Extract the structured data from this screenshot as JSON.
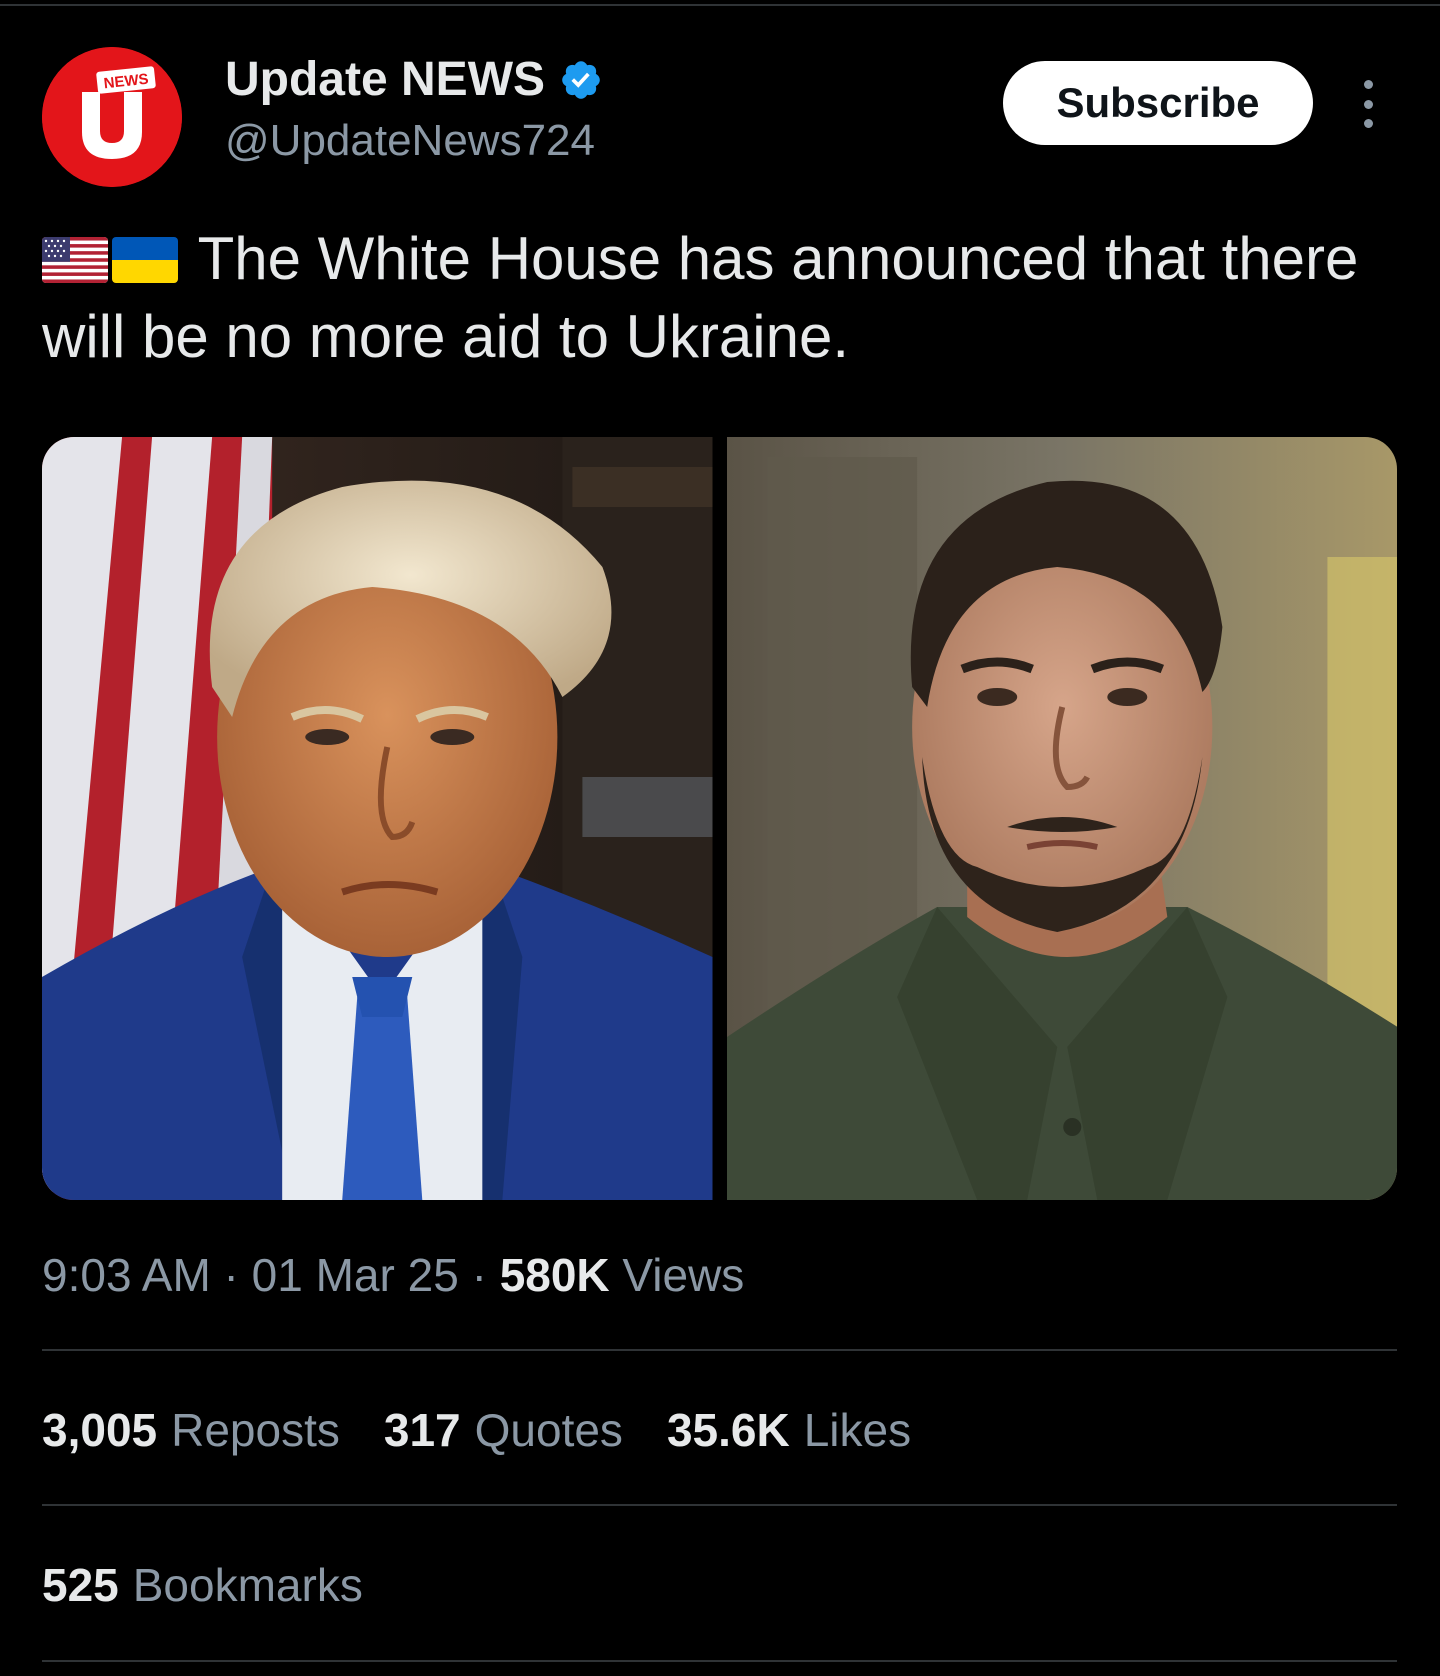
{
  "account": {
    "display_name": "Update NEWS",
    "handle": "@UpdateNews724",
    "avatar_badge": "NEWS",
    "avatar_letter": "U",
    "verified_color": "#1d9bf0",
    "brand_color": "#e3151a"
  },
  "actions": {
    "subscribe_label": "Subscribe",
    "more_icon": "more-vertical-icon"
  },
  "tweet": {
    "flags": [
      "us-flag-icon",
      "ukraine-flag-icon"
    ],
    "text": "The White House has announced that there will be no more aid to Ukraine."
  },
  "meta": {
    "time": "9:03 AM",
    "sep1": " · ",
    "date": "01 Mar 25",
    "sep2": " · ",
    "views_count": "580K",
    "views_label": " Views"
  },
  "stats": {
    "reposts_count": "3,005",
    "reposts_label": "Reposts",
    "quotes_count": "317",
    "quotes_label": "Quotes",
    "likes_count": "35.6K",
    "likes_label": "Likes",
    "bookmarks_count": "525",
    "bookmarks_label": "Bookmarks"
  }
}
